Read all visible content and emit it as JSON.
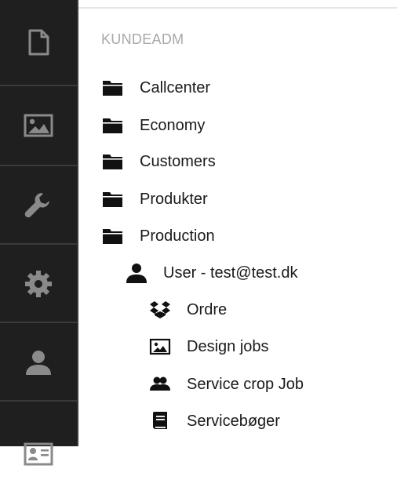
{
  "sidebar": {
    "items": [
      {
        "icon": "document-icon"
      },
      {
        "icon": "image-icon"
      },
      {
        "icon": "wrench-icon"
      },
      {
        "icon": "gear-icon"
      },
      {
        "icon": "user-icon"
      },
      {
        "icon": "id-card-icon"
      }
    ],
    "icon_color": "#8a8a8a",
    "background": "#1f1f1f"
  },
  "main": {
    "section_title": "KUNDEADM",
    "tree": [
      {
        "label": "Callcenter",
        "icon": "folder-icon",
        "level": 0
      },
      {
        "label": "Economy",
        "icon": "folder-icon",
        "level": 0
      },
      {
        "label": "Customers",
        "icon": "folder-icon",
        "level": 0
      },
      {
        "label": "Produkter",
        "icon": "folder-icon",
        "level": 0
      },
      {
        "label": "Production",
        "icon": "folder-icon",
        "level": 0
      },
      {
        "label": "User - test@test.dk",
        "icon": "user-icon",
        "level": 1
      },
      {
        "label": "Ordre",
        "icon": "dropbox-icon",
        "level": 2
      },
      {
        "label": "Design jobs",
        "icon": "picture-icon",
        "level": 2
      },
      {
        "label": "Service crop Job",
        "icon": "users-icon",
        "level": 2
      },
      {
        "label": "Servicebøger",
        "icon": "book-icon",
        "level": 2
      }
    ]
  }
}
